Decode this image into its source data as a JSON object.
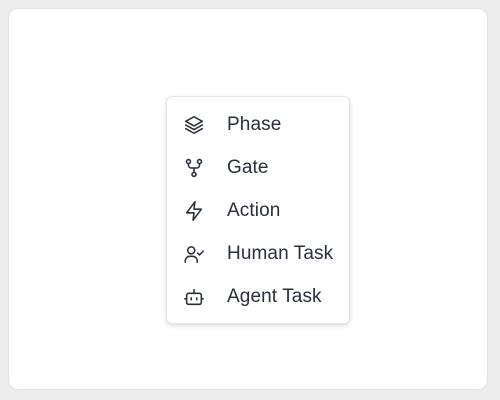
{
  "menu": {
    "items": [
      {
        "label": "Phase",
        "icon": "layers-icon"
      },
      {
        "label": "Gate",
        "icon": "git-fork-icon"
      },
      {
        "label": "Action",
        "icon": "lightning-icon"
      },
      {
        "label": "Human Task",
        "icon": "user-check-icon"
      },
      {
        "label": "Agent Task",
        "icon": "bot-icon"
      }
    ]
  },
  "colors": {
    "text": "#2a2f3a",
    "background": "#ededed",
    "panel": "#ffffff"
  }
}
